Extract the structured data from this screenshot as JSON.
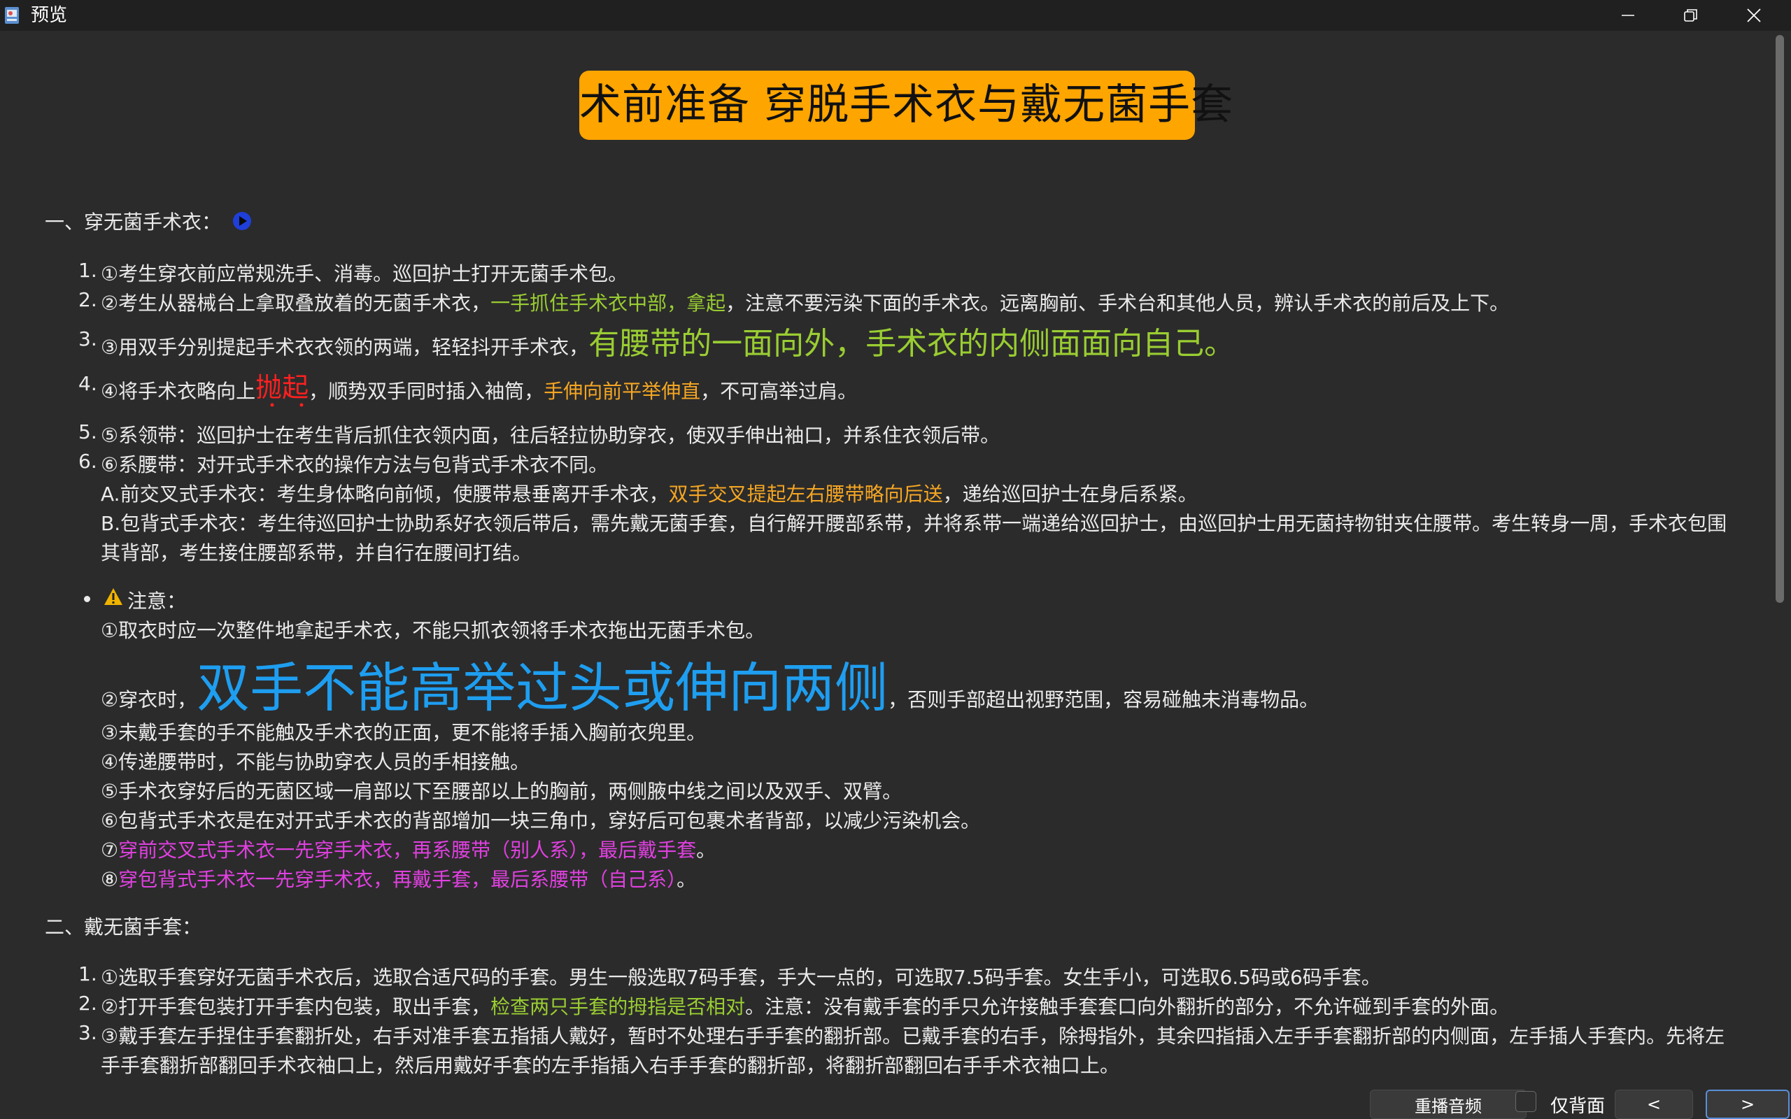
{
  "window": {
    "title": "预览",
    "icon": "app-preview-icon"
  },
  "banner": "术前准备 穿脱手术衣与戴无菌手套",
  "section1": {
    "title": "一、穿无菌手术衣：",
    "items": [
      {
        "num": "1.",
        "text": "①考生穿衣前应常规洗手、消毒。巡回护士打开无菌手术包。"
      },
      {
        "num": "2.",
        "pre": "②考生从器械台上拿取叠放着的无菌手术衣，",
        "hl": "一手抓住手术衣中部，拿起",
        "post": "，注意不要污染下面的手术衣。远离胸前、手术台和其他人员，辨认手术衣的前后及上下。"
      },
      {
        "num": "3.",
        "pre": "③用双手分别提起手术衣衣领的两端，轻轻抖开手术衣，",
        "hl": "有腰带的一面向外，手术衣的内侧面面向自己",
        "post": "。"
      },
      {
        "num": "4.",
        "pre": "④将手术衣略向上",
        "hl": "抛起",
        "mid": "，顺势双手同时插入袖筒，",
        "hl2": "手伸向前平举伸直",
        "post": "，不可高举过肩。"
      },
      {
        "num": "5.",
        "text": "⑤系领带：巡回护士在考生背后抓住衣领内面，往后轻拉协助穿衣，使双手伸出袖口，并系住衣领后带。"
      },
      {
        "num": "6.",
        "text": "⑥系腰带：对开式手术衣的操作方法与包背式手术衣不同。"
      }
    ],
    "sub_a": {
      "pre": "A.前交叉式手术衣：考生身体略向前倾，使腰带悬垂离开手术衣，",
      "hl": "双手交叉提起左右腰带略向后送",
      "post": "，递给巡回护士在身后系紧。"
    },
    "sub_b": {
      "line1": "B.包背式手术衣：考生待巡回护士协助系好衣领后带后，需先戴无菌手套，自行解开腰部系带，并将系带一端递给巡回护士，由巡回护士用无菌持物钳夹住腰带。考生转身一周，手术衣包围",
      "line2": "其背部，考生接住腰部系带，并自行在腰间打结。"
    },
    "notice": {
      "label": "注意：",
      "n1": "①取衣时应一次整件地拿起手术衣，不能只抓衣领将手术衣拖出无菌手术包。",
      "n2_pre": "②穿衣时，",
      "n2_hl": "双手不能高举过头或伸向两侧",
      "n2_post": "，否则手部超出视野范围，容易碰触未消毒物品。",
      "n3": "③未戴手套的手不能触及手术衣的正面，更不能将手插入胸前衣兜里。",
      "n4": "④传递腰带时，不能与协助穿衣人员的手相接触。",
      "n5": "⑤手术衣穿好后的无菌区域一肩部以下至腰部以上的胸前，两侧腋中线之间以及双手、双臂。",
      "n6": "⑥包背式手术衣是在对开式手术衣的背部增加一块三角巾，穿好后可包裹术者背部，以减少污染机会。",
      "n7_pre": "⑦",
      "n7_hl": "穿前交叉式手术衣一先穿手术衣，再系腰带（别人系），最后戴手套",
      "n7_post": "。",
      "n8_pre": "⑧",
      "n8_hl": "穿包背式手术衣一先穿手术衣，再戴手套，最后系腰带（自己系）",
      "n8_post": "。"
    }
  },
  "section2": {
    "title": "二、戴无菌手套：",
    "items": [
      {
        "num": "1.",
        "text": "①选取手套穿好无菌手术衣后，选取合适尺码的手套。男生一般选取7码手套，手大一点的，可选取7.5码手套。女生手小，可选取6.5码或6码手套。"
      },
      {
        "num": "2.",
        "pre": "②打开手套包装打开手套内包装，取出手套，",
        "hl": "检查两只手套的拇指是否相对",
        "post": "。注意：没有戴手套的手只允许接触手套套口向外翻折的部分，不允许碰到手套的外面。"
      },
      {
        "num": "3.",
        "line1": "③戴手套左手捏住手套翻折处，右手对准手套五指插人戴好，暂时不处理右手手套的翻折部。已戴手套的右手，除拇指外，其余四指插入左手手套翻折部的内侧面，左手插人手套内。先将左",
        "line2": "手手套翻折部翻回手术衣袖口上，然后用戴好手套的左手指插入右手手套的翻折部，将翻折部翻回右手手术衣袖口上。"
      }
    ]
  },
  "controls": {
    "replay": "重播音频",
    "checkbox_label": "仅背面",
    "prev": "<",
    "next": ">"
  },
  "colors": {
    "background": "#2b2b2b",
    "banner": "#ffa500",
    "green_highlight": "#9acd32",
    "orange_highlight": "#f5a623",
    "red_highlight": "#ff2020",
    "blue_highlight": "#1e9ef0",
    "magenta_highlight": "#e040e0"
  }
}
